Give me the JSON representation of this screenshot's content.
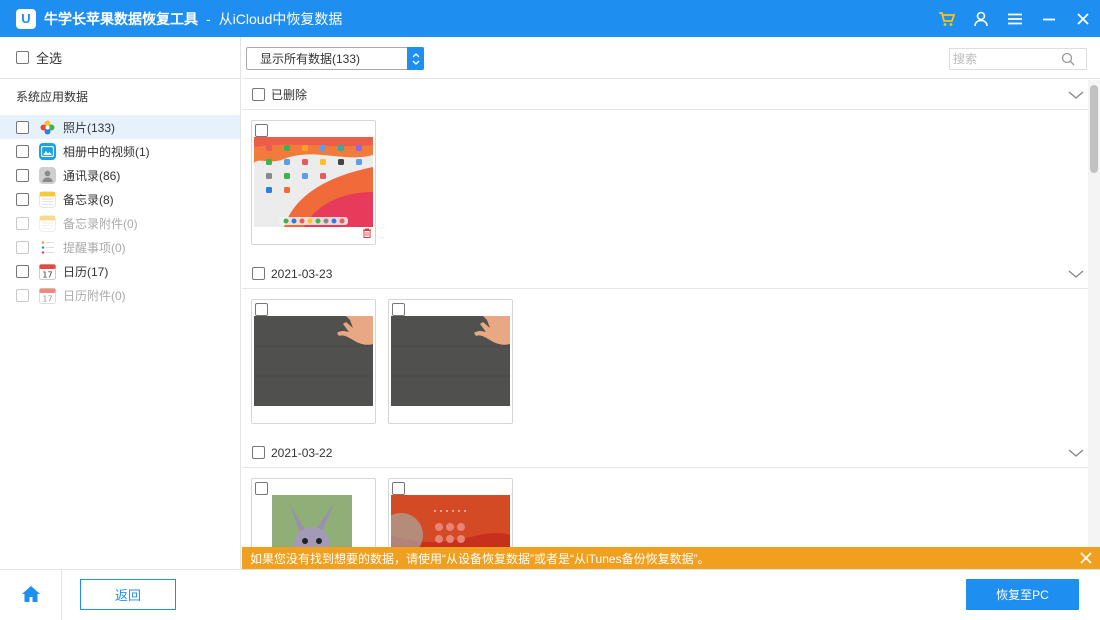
{
  "titlebar": {
    "logo_letter": "U",
    "app_title": "牛学长苹果数据恢复工具",
    "separator": "-",
    "page_title": "从iCloud中恢复数据",
    "icons": [
      "cart-icon",
      "user-icon",
      "menu-icon",
      "minimize-icon",
      "close-icon"
    ]
  },
  "sidebar": {
    "select_all_label": "全选",
    "group_title": "系统应用数据",
    "items": [
      {
        "label": "照片(133)",
        "icon": "photos-icon",
        "active": true,
        "disabled": false
      },
      {
        "label": "相册中的视频(1)",
        "icon": "album-video-icon",
        "active": false,
        "disabled": false
      },
      {
        "label": "通讯录(86)",
        "icon": "contacts-icon",
        "active": false,
        "disabled": false
      },
      {
        "label": "备忘录(8)",
        "icon": "notes-icon",
        "active": false,
        "disabled": false
      },
      {
        "label": "备忘录附件(0)",
        "icon": "notes-attachment-icon",
        "active": false,
        "disabled": true
      },
      {
        "label": "提醒事项(0)",
        "icon": "reminders-icon",
        "active": false,
        "disabled": true
      },
      {
        "label": "日历(17)",
        "icon": "calendar-icon",
        "active": false,
        "disabled": false
      },
      {
        "label": "日历附件(0)",
        "icon": "calendar-attachment-icon",
        "active": false,
        "disabled": true
      }
    ]
  },
  "toolbar": {
    "filter_value": "显示所有数据(133)",
    "search_placeholder": "搜索"
  },
  "sections": [
    {
      "label": "已删除",
      "thumbnails": 1
    },
    {
      "label": "2021-03-23",
      "thumbnails": 2
    },
    {
      "label": "2021-03-22",
      "thumbnails": 2
    }
  ],
  "notice": {
    "text": "如果您没有找到想要的数据，请使用“从设备恢复数据”或者是“从iTunes备份恢复数据”。"
  },
  "bottom": {
    "back_label": "返回",
    "recover_label": "恢复至PC"
  },
  "colors": {
    "accent": "#1f8ef1",
    "notice": "#f0a01e",
    "active_row": "#e6f1fc"
  }
}
